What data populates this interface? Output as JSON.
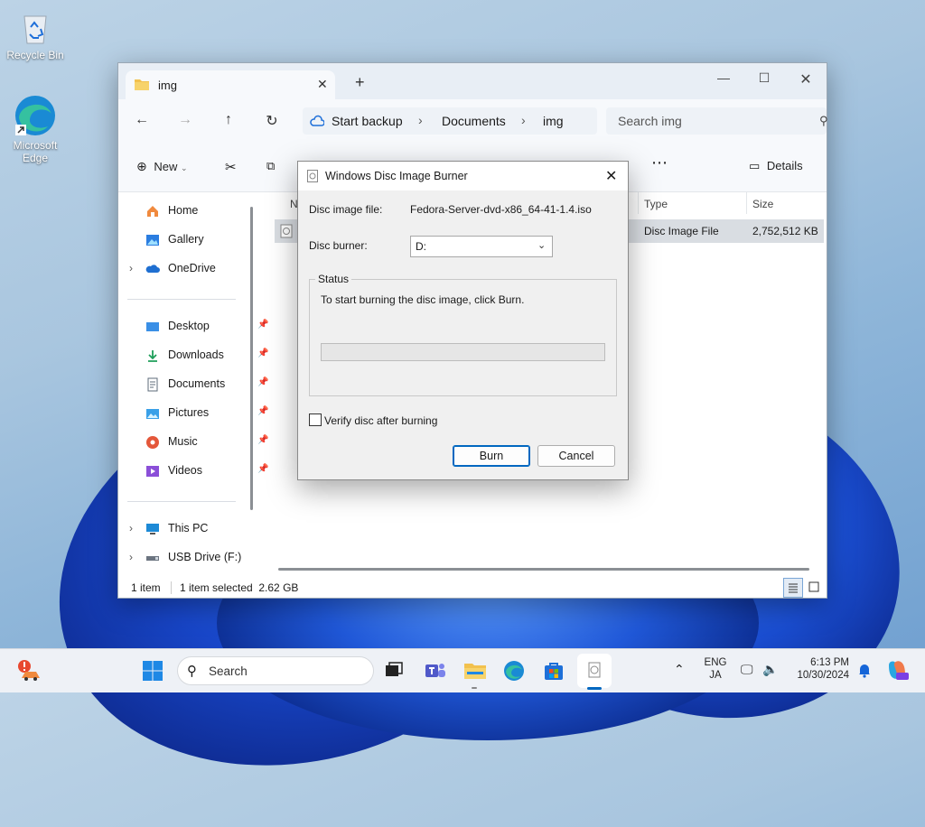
{
  "desktop": {
    "icons": [
      {
        "label": "Recycle Bin"
      },
      {
        "label": "Microsoft Edge"
      }
    ]
  },
  "explorer": {
    "tab_title": "img",
    "address": {
      "start_backup": "Start backup",
      "crumbs": [
        "Documents",
        "img"
      ]
    },
    "search_placeholder": "Search img",
    "toolbar": {
      "new_label": "New",
      "details_label": "Details"
    },
    "sidebar": {
      "top_items": [
        "Home",
        "Gallery",
        "OneDrive"
      ],
      "pinned_items": [
        "Desktop",
        "Downloads",
        "Documents",
        "Pictures",
        "Music",
        "Videos"
      ],
      "bottom_items": [
        "This PC",
        "USB Drive (F:)"
      ]
    },
    "columns": {
      "name": "N",
      "type": "Type",
      "size": "Size"
    },
    "file_row": {
      "type": "Disc Image File",
      "size": "2,752,512 KB"
    },
    "status": {
      "count": "1 item",
      "selected": "1 item selected  2.62 GB"
    }
  },
  "dialog": {
    "title": "Windows Disc Image Burner",
    "disc_image_label": "Disc image file:",
    "disc_image_value": "Fedora-Server-dvd-x86_64-41-1.4.iso",
    "disc_burner_label": "Disc burner:",
    "disc_burner_value": "D:",
    "status_title": "Status",
    "status_text": "To start burning the disc image, click Burn.",
    "progress": 0,
    "verify_label": "Verify disc after burning",
    "verify_checked": false,
    "burn_label": "Burn",
    "cancel_label": "Cancel"
  },
  "taskbar": {
    "search_placeholder": "Search",
    "lang_top": "ENG",
    "lang_bottom": "JA",
    "time": "6:13 PM",
    "date": "10/30/2024"
  },
  "colors": {
    "accent": "#0067c0",
    "selection": "#d9dde2"
  }
}
